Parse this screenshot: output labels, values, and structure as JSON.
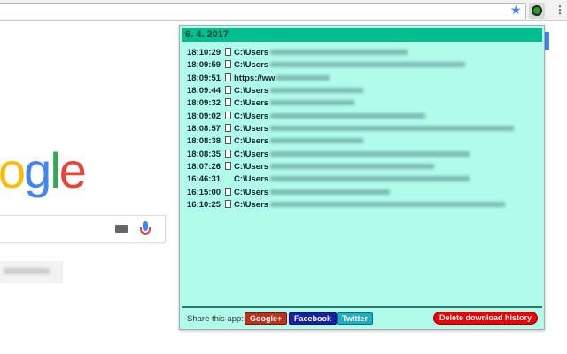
{
  "browser": {
    "star_icon": "star-icon",
    "extension_icon": "download-history-icon",
    "menu_icon": "more-vert-icon"
  },
  "google": {
    "logo_partial": "gle",
    "logo_colors": [
      "#fbbc05",
      "#4285f4",
      "#34a853",
      "#ea4335"
    ]
  },
  "popup": {
    "date": "6. 4. 2017",
    "accent": "#00be90",
    "background": "#b1fbea",
    "downloads": [
      {
        "time": "18:10:29",
        "icon": "file-icon",
        "path": "C:\\Users"
      },
      {
        "time": "18:09:59",
        "icon": "file-icon",
        "path": "C:\\Users"
      },
      {
        "time": "18:09:51",
        "icon": "file-icon",
        "path": "https://ww"
      },
      {
        "time": "18:09:44",
        "icon": "file-icon",
        "path": "C:\\Users"
      },
      {
        "time": "18:09:32",
        "icon": "file-icon",
        "path": "C:\\Users"
      },
      {
        "time": "18:09:02",
        "icon": "file-icon",
        "path": "C:\\Users"
      },
      {
        "time": "18:08:57",
        "icon": "file-icon",
        "path": "C:\\Users"
      },
      {
        "time": "18:08:38",
        "icon": "file-icon",
        "path": "C:\\Users"
      },
      {
        "time": "18:08:35",
        "icon": "file-icon",
        "path": "C:\\Users"
      },
      {
        "time": "18:07:26",
        "icon": "file-icon",
        "path": "C:\\Users"
      },
      {
        "time": "16:46:31",
        "icon": "",
        "path": "C:\\Users"
      },
      {
        "time": "16:15:00",
        "icon": "file-icon",
        "path": "C:\\Users"
      },
      {
        "time": "16:10:25",
        "icon": "file-icon",
        "path": "C:\\Users"
      }
    ],
    "footer": {
      "share_label": "Share this app:",
      "google_plus": "Google+",
      "facebook": "Facebook",
      "twitter": "Twitter",
      "delete": "Delete download history"
    }
  }
}
